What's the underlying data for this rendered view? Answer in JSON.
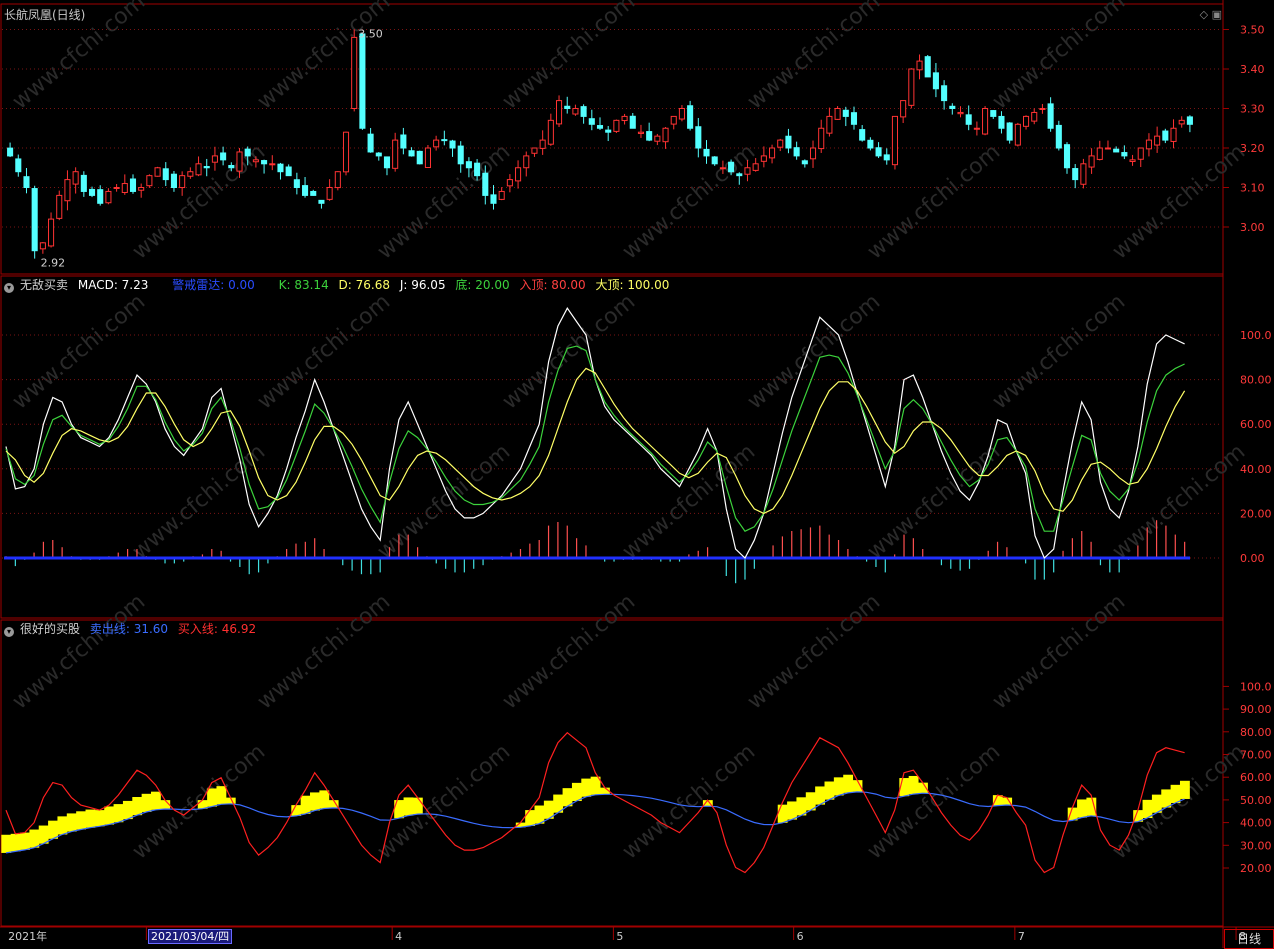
{
  "panel1": {
    "title": "长航凤凰(日线)",
    "high_label": "3.50",
    "low_label": "2.92",
    "yticks": [
      "3.50",
      "3.40",
      "3.30",
      "3.20",
      "3.10",
      "3.00"
    ],
    "yvals": [
      3.5,
      3.4,
      3.3,
      3.2,
      3.1,
      3.0
    ]
  },
  "panel2": {
    "name": "无敌买卖",
    "macd": "MACD: 7.23",
    "alert": "警戒雷达: 0.00",
    "k": "K: 83.14",
    "d": "D: 76.68",
    "j": "J: 96.05",
    "bottom": "底: 20.00",
    "enter_top": "入顶: 80.00",
    "big_top": "大顶: 100.00",
    "yticks": [
      "100.0",
      "80.00",
      "60.00",
      "40.00",
      "20.00",
      "0.00"
    ],
    "yvals": [
      100,
      80,
      60,
      40,
      20,
      0
    ]
  },
  "panel3": {
    "name": "很好的买股",
    "sell": "卖出线: 31.60",
    "buy": "买入线: 46.92",
    "yticks": [
      "100.0",
      "90.00",
      "80.00",
      "70.00",
      "60.00",
      "50.00",
      "40.00",
      "30.00",
      "20.00"
    ],
    "yvals": [
      100,
      90,
      80,
      70,
      60,
      50,
      40,
      30,
      20
    ]
  },
  "xaxis": {
    "labels": [
      {
        "text": "2021年",
        "i": 0
      },
      {
        "text": "3",
        "i": 17
      },
      {
        "text": "4",
        "i": 47
      },
      {
        "text": "5",
        "i": 74
      },
      {
        "text": "6",
        "i": 96
      },
      {
        "text": "7",
        "i": 123
      },
      {
        "text": "8",
        "i": 150
      }
    ],
    "cursor_date": "2021/03/04/四",
    "period": "日线"
  },
  "watermark": "www.cfchi.com",
  "colors": {
    "up": "#ff3333",
    "down": "#54ffff",
    "k": "#ffffff",
    "d": "#3cd23c",
    "j": "#ffff66",
    "sell": "#3a6cff",
    "buy": "#ff2020",
    "fill": "#ffff00"
  },
  "chart_data": {
    "type": "candlestick",
    "close": [
      3.18,
      3.14,
      3.1,
      2.94,
      2.96,
      3.02,
      3.08,
      3.12,
      3.14,
      3.09,
      3.08,
      3.06,
      3.09,
      3.1,
      3.11,
      3.09,
      3.1,
      3.13,
      3.15,
      3.12,
      3.1,
      3.13,
      3.14,
      3.16,
      3.15,
      3.18,
      3.17,
      3.15,
      3.19,
      3.18,
      3.17,
      3.16,
      3.16,
      3.14,
      3.13,
      3.1,
      3.08,
      3.08,
      3.06,
      3.1,
      3.14,
      3.24,
      3.48,
      3.25,
      3.19,
      3.18,
      3.15,
      3.22,
      3.2,
      3.18,
      3.16,
      3.2,
      3.22,
      3.22,
      3.2,
      3.16,
      3.15,
      3.13,
      3.08,
      3.06,
      3.09,
      3.12,
      3.15,
      3.18,
      3.2,
      3.22,
      3.27,
      3.32,
      3.3,
      3.3,
      3.28,
      3.26,
      3.25,
      3.24,
      3.27,
      3.28,
      3.25,
      3.24,
      3.22,
      3.23,
      3.25,
      3.28,
      3.3,
      3.25,
      3.2,
      3.18,
      3.16,
      3.15,
      3.14,
      3.13,
      3.15,
      3.16,
      3.18,
      3.2,
      3.22,
      3.2,
      3.18,
      3.16,
      3.2,
      3.25,
      3.28,
      3.3,
      3.28,
      3.26,
      3.22,
      3.2,
      3.18,
      3.17,
      3.28,
      3.32,
      3.4,
      3.42,
      3.38,
      3.35,
      3.32,
      3.3,
      3.29,
      3.26,
      3.25,
      3.3,
      3.28,
      3.25,
      3.22,
      3.26,
      3.28,
      3.29,
      3.3,
      3.25,
      3.2,
      3.15,
      3.12,
      3.16,
      3.18,
      3.2,
      3.2,
      3.19,
      3.18,
      3.17,
      3.2,
      3.22,
      3.23,
      3.22,
      3.25,
      3.27,
      3.26
    ],
    "kdj": {
      "k": [
        50,
        31,
        32,
        40,
        60,
        72,
        70,
        60,
        54,
        52,
        50,
        54,
        62,
        72,
        82,
        78,
        70,
        58,
        50,
        46,
        52,
        58,
        72,
        76,
        60,
        44,
        24,
        14,
        20,
        28,
        40,
        54,
        66,
        80,
        70,
        58,
        46,
        34,
        22,
        14,
        8,
        40,
        62,
        70,
        60,
        50,
        40,
        30,
        22,
        18,
        18,
        20,
        24,
        28,
        34,
        40,
        50,
        60,
        88,
        104,
        112,
        106,
        100,
        80,
        68,
        62,
        58,
        54,
        50,
        46,
        40,
        36,
        32,
        40,
        48,
        58,
        48,
        22,
        4,
        0,
        8,
        20,
        38,
        56,
        72,
        84,
        96,
        108,
        104,
        100,
        88,
        74,
        60,
        46,
        32,
        50,
        80,
        82,
        72,
        60,
        48,
        38,
        30,
        26,
        34,
        46,
        62,
        60,
        48,
        38,
        10,
        0,
        4,
        30,
        52,
        70,
        62,
        34,
        22,
        18,
        30,
        50,
        78,
        96,
        100,
        98,
        96
      ],
      "d": [
        48,
        40,
        34,
        34,
        42,
        52,
        58,
        58,
        56,
        54,
        52,
        52,
        56,
        62,
        72,
        76,
        72,
        64,
        56,
        50,
        50,
        54,
        62,
        68,
        64,
        54,
        42,
        30,
        26,
        26,
        30,
        38,
        48,
        58,
        60,
        58,
        54,
        48,
        40,
        32,
        24,
        28,
        36,
        44,
        48,
        48,
        46,
        42,
        38,
        34,
        30,
        28,
        26,
        26,
        28,
        30,
        34,
        40,
        52,
        64,
        76,
        84,
        86,
        80,
        72,
        66,
        60,
        56,
        52,
        48,
        44,
        40,
        36,
        36,
        40,
        46,
        48,
        42,
        32,
        24,
        20,
        20,
        24,
        32,
        42,
        52,
        62,
        72,
        78,
        80,
        78,
        72,
        64,
        56,
        48,
        46,
        54,
        60,
        62,
        60,
        56,
        50,
        44,
        38,
        36,
        38,
        44,
        48,
        48,
        44,
        34,
        24,
        20,
        22,
        30,
        40,
        44,
        42,
        38,
        34,
        32,
        36,
        44,
        54,
        64,
        72,
        78
      ]
    }
  }
}
